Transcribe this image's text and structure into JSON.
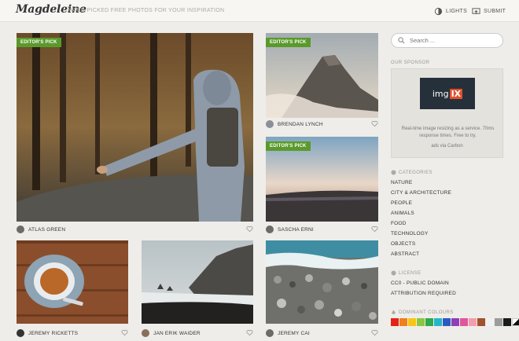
{
  "header": {
    "logo": "Magdeleine",
    "tagline": "HAND-PICKED FREE PHOTOS FOR YOUR INSPIRATION",
    "lights_label": "LIGHTS",
    "submit_label": "SUBMIT"
  },
  "badge_label": "EDITOR'S PICK",
  "photos": [
    {
      "author": "ATLAS GREEN",
      "editors_pick": true
    },
    {
      "author": "BRENDAN LYNCH",
      "editors_pick": true
    },
    {
      "author": "SASCHA ERNI",
      "editors_pick": true
    },
    {
      "author": "JEREMY RICKETTS",
      "editors_pick": false
    },
    {
      "author": "JAN ERIK WAIDER",
      "editors_pick": false
    },
    {
      "author": "JEREMY CAI",
      "editors_pick": false
    }
  ],
  "sidebar": {
    "search_placeholder": "Search ...",
    "sponsor_title": "OUR SPONSOR",
    "sponsor_logo": "img",
    "sponsor_logo_ix": "IX",
    "sponsor_text": "Real-time image resizing as a service. 70ms response times. Free to try.",
    "sponsor_via": "ads via Carbon",
    "categories_title": "CATEGORIES",
    "categories": [
      "NATURE",
      "CITY & ARCHITECTURE",
      "PEOPLE",
      "ANIMALS",
      "FOOD",
      "TECHNOLOGY",
      "OBJECTS",
      "ABSTRACT"
    ],
    "license_title": "LICENSE",
    "licenses": [
      "CC0 - PUBLIC DOMAIN",
      "ATTRIBUTION REQUIRED"
    ],
    "colours_title": "DOMINANT COLOURS",
    "colours": [
      "#e2231a",
      "#f07f1e",
      "#f6c614",
      "#8cc63f",
      "#2fa84f",
      "#25b6c9",
      "#2a5bbf",
      "#8e3fb8",
      "#e0569c",
      "#f29db0",
      "#a0522d",
      "#f1f1f1",
      "#9c9c9c",
      "#1a1a1a",
      "bw"
    ]
  }
}
